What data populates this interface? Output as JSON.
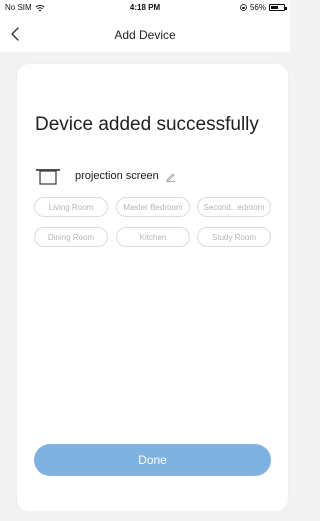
{
  "status_bar": {
    "carrier": "No SIM",
    "time": "4:18 PM",
    "battery": "56%",
    "battery_level": 0.56
  },
  "nav": {
    "title": "Add Device"
  },
  "card": {
    "title": "Device added successfully",
    "device_name": "projection screen",
    "rooms": [
      "Living Room",
      "Master Bedroom",
      "Second...edroom",
      "Dining Room",
      "Kitchen",
      "Study Room"
    ],
    "done_label": "Done"
  },
  "colors": {
    "accent": "#7fb1e1",
    "chip_border": "#dcdcdc",
    "chip_text": "#b5b5b5",
    "background": "#f2f2f2"
  }
}
